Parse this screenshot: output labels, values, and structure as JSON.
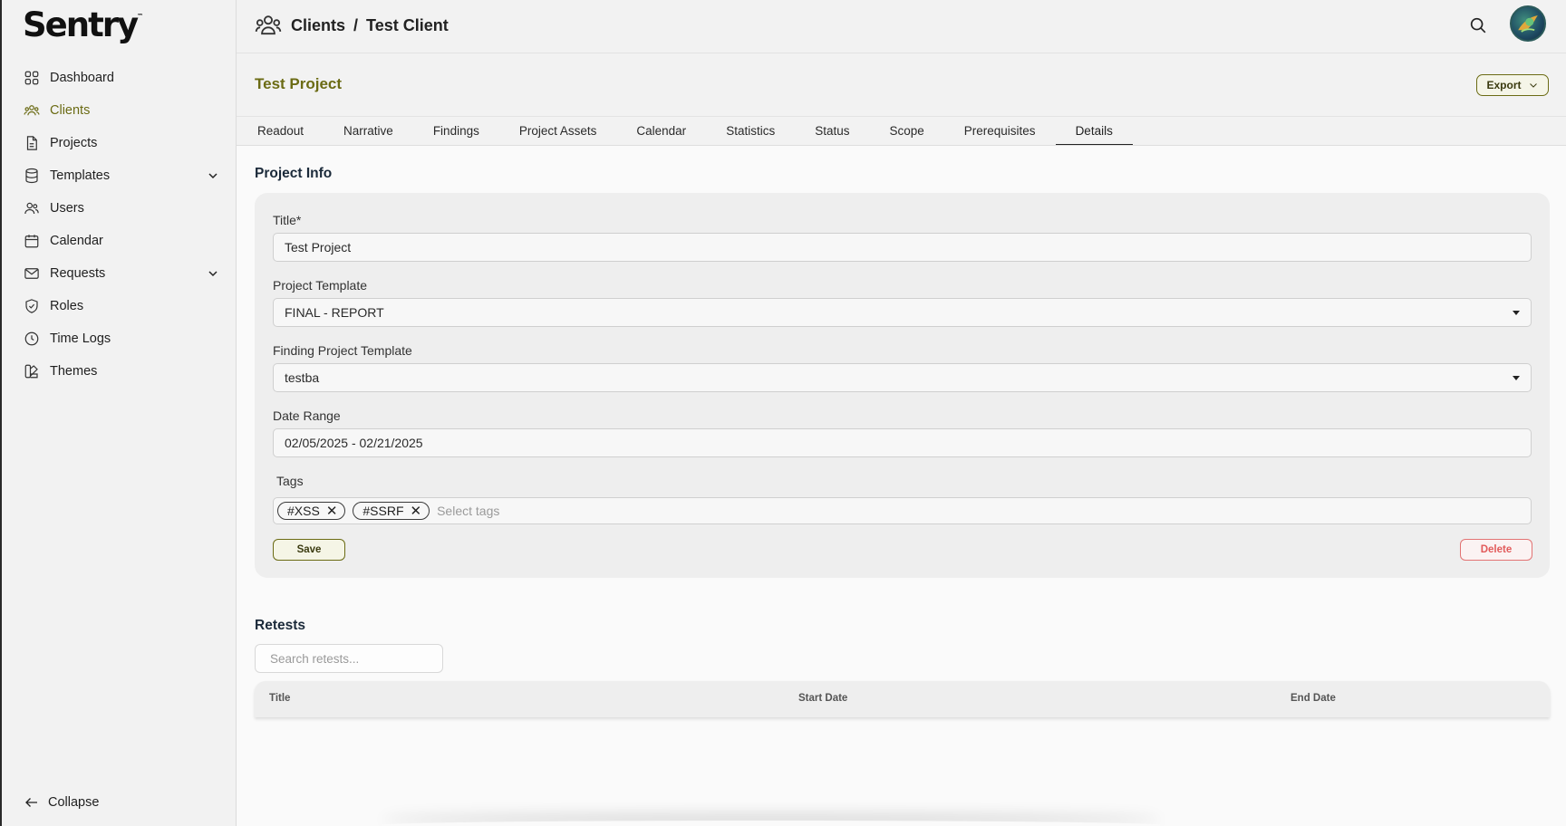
{
  "app": {
    "logo": "Sentry",
    "logo_mark": "™"
  },
  "sidebar": {
    "items": [
      {
        "label": "Dashboard",
        "icon": "grid-icon"
      },
      {
        "label": "Clients",
        "icon": "users-group-icon",
        "active": true
      },
      {
        "label": "Projects",
        "icon": "document-icon"
      },
      {
        "label": "Templates",
        "icon": "database-icon",
        "expandable": true
      },
      {
        "label": "Users",
        "icon": "users-icon"
      },
      {
        "label": "Calendar",
        "icon": "calendar-icon"
      },
      {
        "label": "Requests",
        "icon": "mail-icon",
        "expandable": true
      },
      {
        "label": "Roles",
        "icon": "shield-icon"
      },
      {
        "label": "Time Logs",
        "icon": "clock-icon"
      },
      {
        "label": "Themes",
        "icon": "palette-icon"
      }
    ],
    "collapse_label": "Collapse"
  },
  "header": {
    "crumb_parent": "Clients",
    "crumb_separator": "/",
    "crumb_current": "Test Client"
  },
  "project": {
    "title": "Test Project",
    "export_label": "Export"
  },
  "tabs": [
    {
      "label": "Readout"
    },
    {
      "label": "Narrative"
    },
    {
      "label": "Findings"
    },
    {
      "label": "Project Assets"
    },
    {
      "label": "Calendar"
    },
    {
      "label": "Statistics"
    },
    {
      "label": "Status"
    },
    {
      "label": "Scope"
    },
    {
      "label": "Prerequisites"
    },
    {
      "label": "Details",
      "active": true
    }
  ],
  "project_info": {
    "section_title": "Project Info",
    "title_label": "Title*",
    "title_value": "Test Project",
    "template_label": "Project Template",
    "template_value": "FINAL - REPORT",
    "finding_template_label": "Finding Project Template",
    "finding_template_value": "testba",
    "date_range_label": "Date Range",
    "date_range_value": "02/05/2025 - 02/21/2025",
    "tags_label": "Tags",
    "tags": [
      "#XSS",
      "#SSRF"
    ],
    "tags_placeholder": "Select tags",
    "save_label": "Save",
    "delete_label": "Delete"
  },
  "retests": {
    "section_title": "Retests",
    "search_placeholder": "Search retests...",
    "columns": [
      "Title",
      "Start Date",
      "End Date"
    ]
  },
  "colors": {
    "accent": "#6b6b14",
    "danger": "#e25b5b",
    "background": "#f2f2f2"
  }
}
